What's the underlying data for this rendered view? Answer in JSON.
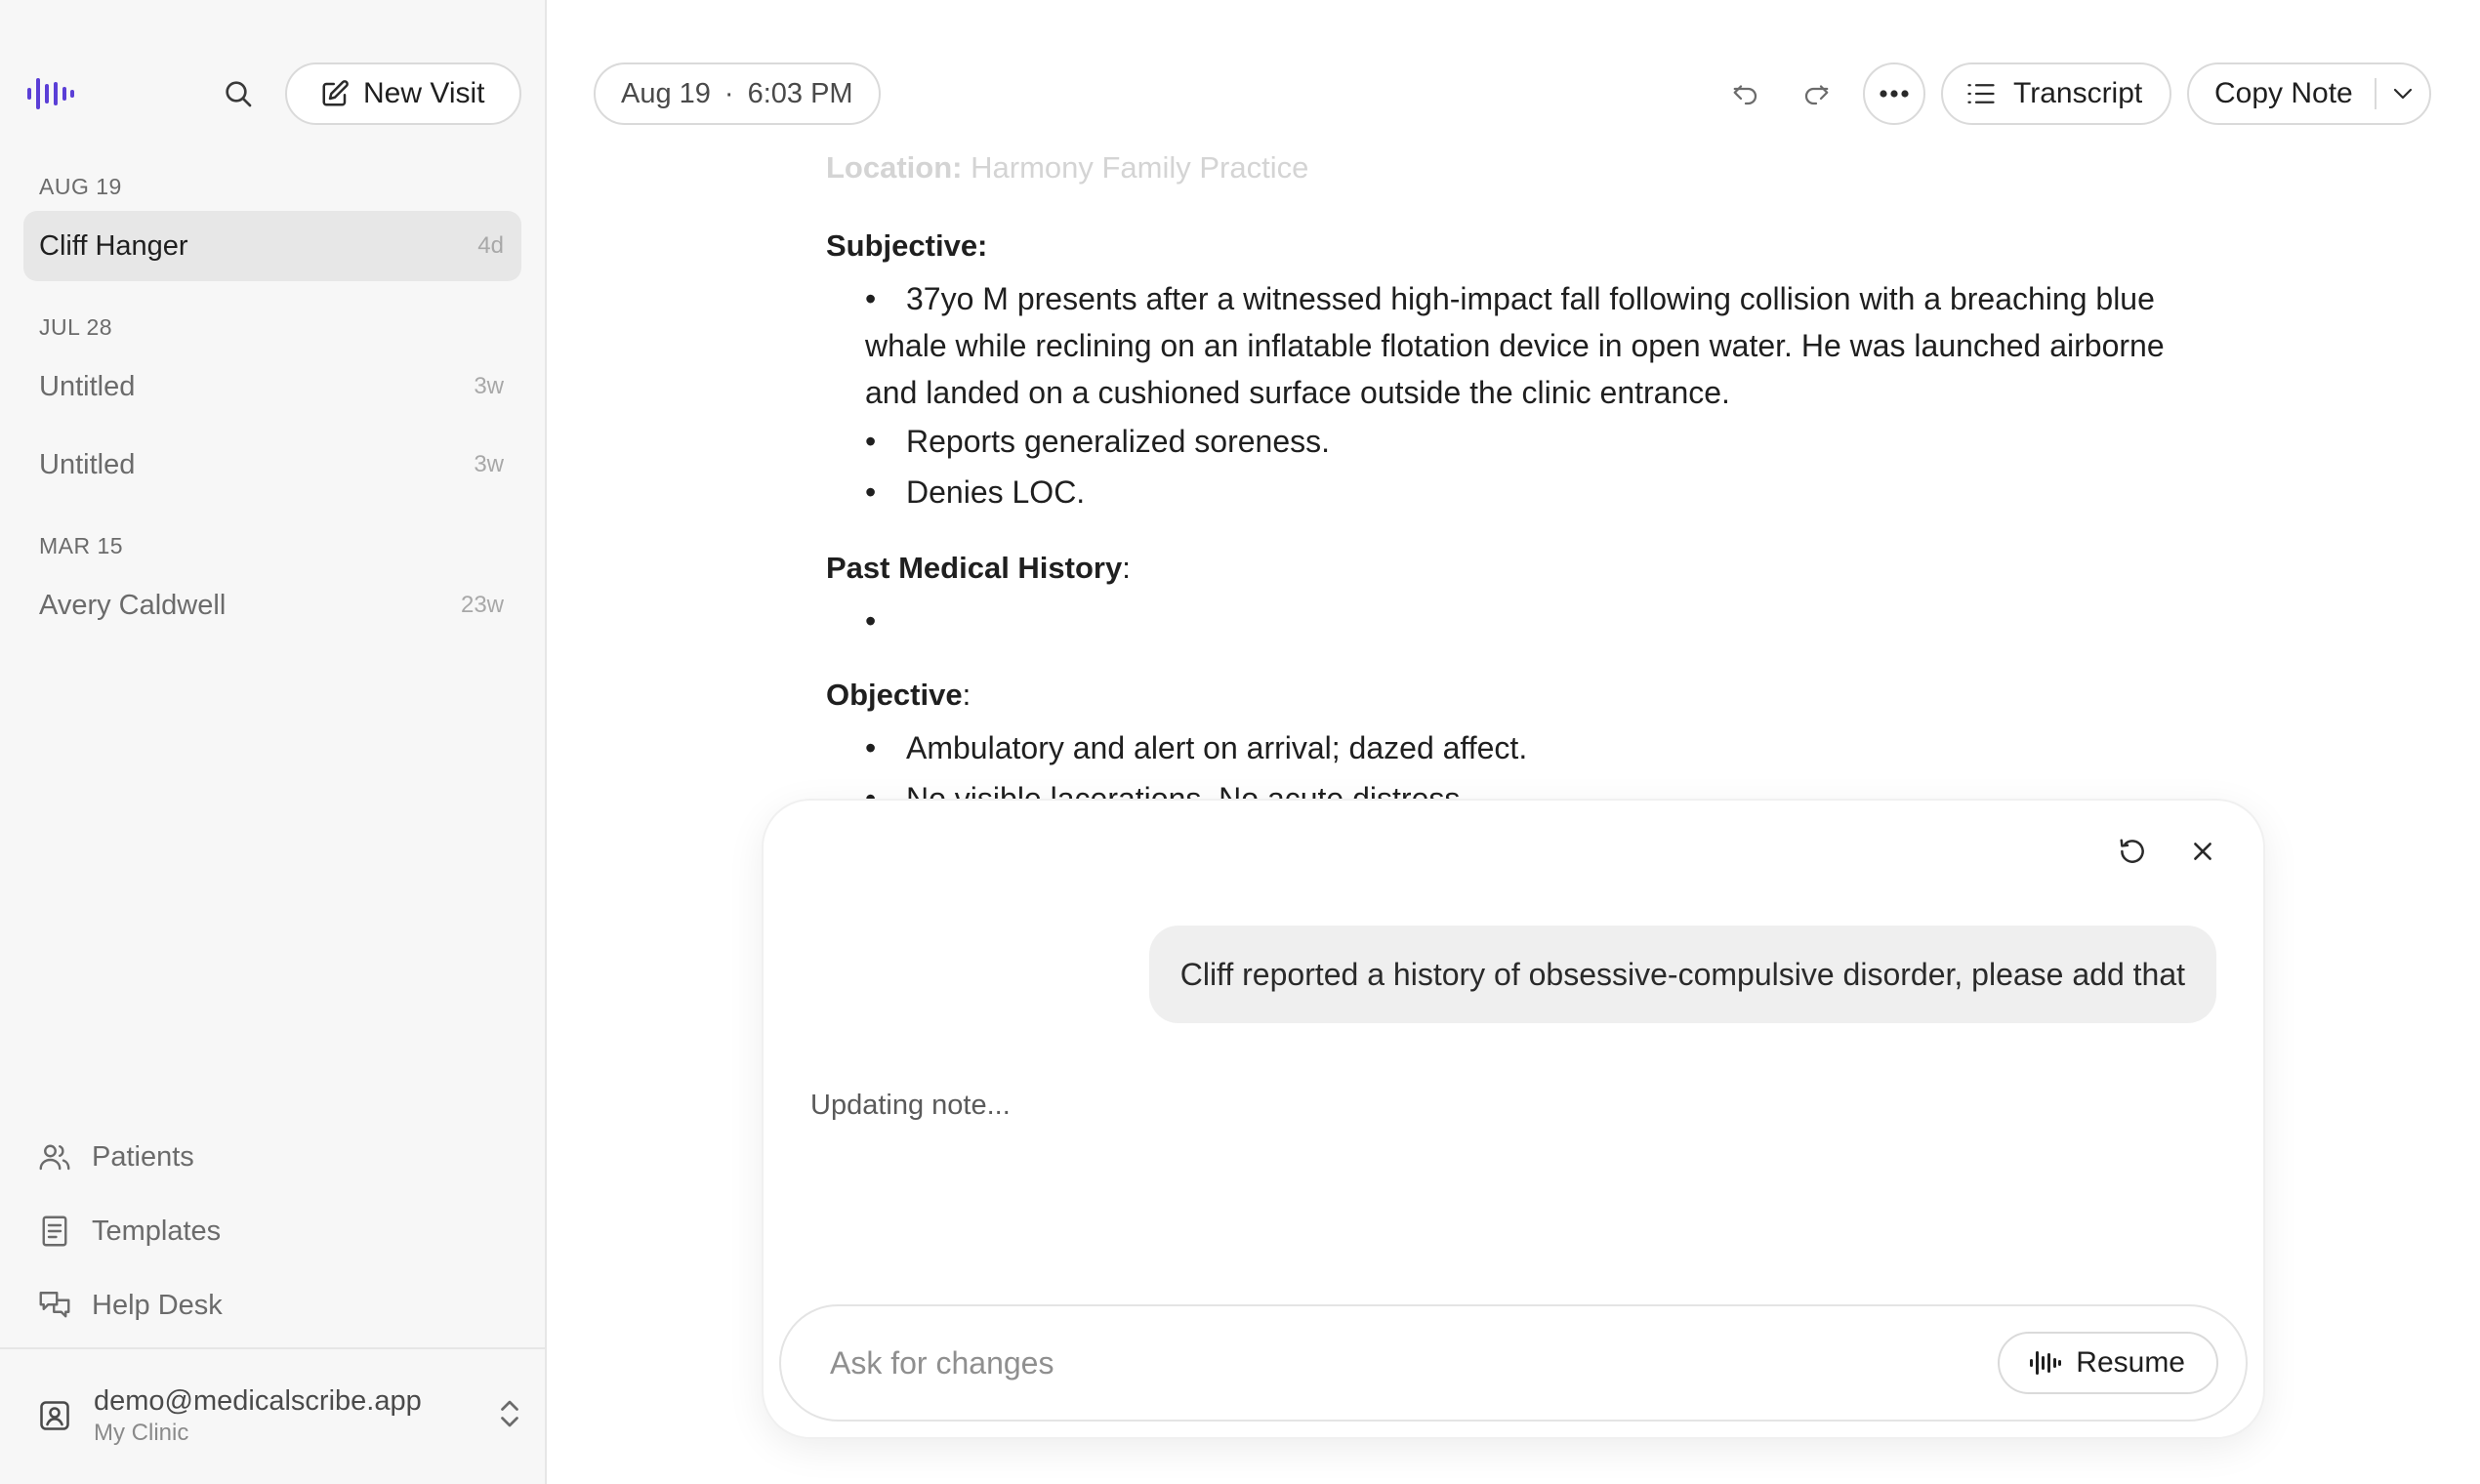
{
  "sidebar": {
    "new_visit_label": "New Visit",
    "groups": [
      {
        "date": "AUG 19",
        "items": [
          {
            "name": "Cliff Hanger",
            "age": "4d",
            "selected": true
          }
        ]
      },
      {
        "date": "JUL 28",
        "items": [
          {
            "name": "Untitled",
            "age": "3w"
          },
          {
            "name": "Untitled",
            "age": "3w"
          }
        ]
      },
      {
        "date": "MAR 15",
        "items": [
          {
            "name": "Avery Caldwell",
            "age": "23w"
          }
        ]
      }
    ],
    "nav": [
      {
        "label": "Patients",
        "icon": "users-icon"
      },
      {
        "label": "Templates",
        "icon": "document-icon"
      },
      {
        "label": "Help Desk",
        "icon": "chat-bubbles-icon"
      }
    ],
    "account": {
      "email": "demo@medicalscribe.app",
      "clinic": "My Clinic"
    }
  },
  "topbar": {
    "date": "Aug 19",
    "separator": "·",
    "time": "6:03 PM",
    "transcript_label": "Transcript",
    "copy_label": "Copy Note"
  },
  "note": {
    "location_label": "Location:",
    "location_value": "Harmony Family Practice",
    "sections": {
      "subjective": {
        "title": "Subjective:",
        "bullets": [
          "37yo M presents after a witnessed high-impact fall following collision with a breaching blue whale while reclining on an inflatable flotation device in open water. He was launched airborne and landed on a cushioned surface outside the clinic entrance.",
          "Reports generalized soreness.",
          "Denies LOC."
        ]
      },
      "pmh": {
        "title": "Past Medical History",
        "colon": ":",
        "bullets": [
          ""
        ]
      },
      "objective": {
        "title": "Objective",
        "colon": ":",
        "bullets": [
          "Ambulatory and alert on arrival; dazed affect.",
          "No visible lacerations. No acute distress."
        ]
      }
    }
  },
  "chat": {
    "user_message": "Cliff reported a history of obsessive-compulsive disorder, please add that",
    "status": "Updating note...",
    "input_placeholder": "Ask for changes",
    "resume_label": "Resume"
  }
}
